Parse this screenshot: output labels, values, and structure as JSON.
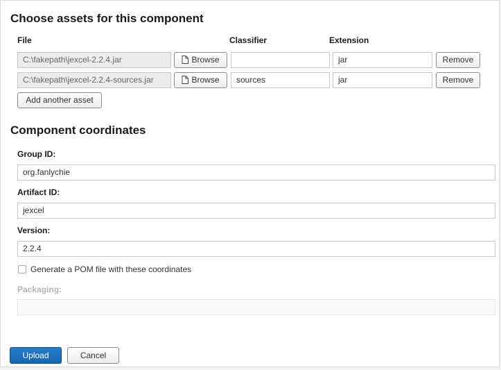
{
  "assets_section": {
    "title": "Choose assets for this component",
    "col_file": "File",
    "col_classifier": "Classifier",
    "col_extension": "Extension",
    "browse_label": "Browse",
    "remove_label": "Remove",
    "add_asset_label": "Add another asset",
    "rows": [
      {
        "file": "C:\\fakepath\\jexcel-2.2.4.jar",
        "classifier": "",
        "extension": "jar"
      },
      {
        "file": "C:\\fakepath\\jexcel-2.2.4-sources.jar",
        "classifier": "sources",
        "extension": "jar"
      }
    ]
  },
  "coordinates_section": {
    "title": "Component coordinates",
    "group_id_label": "Group ID:",
    "group_id_value": "org.fanlychie",
    "artifact_id_label": "Artifact ID:",
    "artifact_id_value": "jexcel",
    "version_label": "Version:",
    "version_value": "2.2.4",
    "generate_pom_label": "Generate a POM file with these coordinates",
    "generate_pom_checked": false,
    "packaging_label": "Packaging:",
    "packaging_value": ""
  },
  "actions": {
    "upload_label": "Upload",
    "cancel_label": "Cancel"
  },
  "colors": {
    "primary": "#1666b0",
    "panel_bg": "#ffffff",
    "page_bg": "#f0f0f0",
    "muted_text": "#b4b4b4"
  }
}
